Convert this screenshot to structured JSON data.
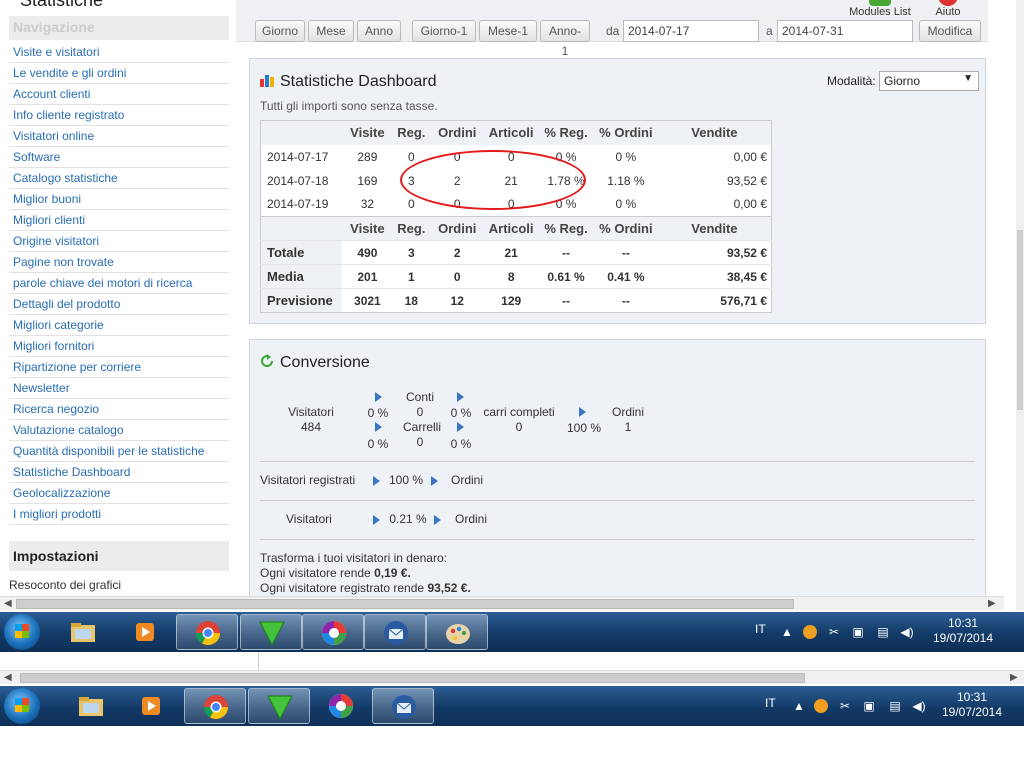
{
  "page": {
    "title": "Statistiche"
  },
  "sidebar": {
    "nav_heading": "Navigazione",
    "items": [
      "Visite e visitatori",
      "Le vendite e gli ordini",
      "Account clienti",
      "Info cliente registrato",
      "Visitatori online",
      "Software",
      "Catalogo statistiche",
      "Miglior buoni",
      "Migliori clienti",
      "Origine visitatori",
      "Pagine non trovate",
      "parole chiave dei motori di ricerca",
      "Dettagli del prodotto",
      "Migliori categorie",
      "Migliori fornitori",
      "Ripartizione per corriere",
      "Newsletter",
      "Ricerca negozio",
      "Valutazione catalogo",
      "Quantità disponibili per le statistiche",
      "Statistiche Dashboard",
      "Geolocalizzazione",
      "I migliori prodotti"
    ],
    "settings_heading": "Impostazioni",
    "settings_item": "Resoconto dei grafici"
  },
  "toolbar": {
    "modules_list": "Modules List",
    "help": "Aiuto",
    "buttons": [
      "Giorno",
      "Mese",
      "Anno",
      "Giorno-1",
      "Mese-1",
      "Anno-1"
    ],
    "from_label": "da",
    "from_value": "2014-07-17",
    "to_label": "a",
    "to_value": "2014-07-31",
    "submit": "Modifica"
  },
  "dashboard": {
    "title": "Statistiche Dashboard",
    "mode_label": "Modalità:",
    "mode_value": "Giorno",
    "note": "Tutti gli importi sono senza tasse.",
    "headers": [
      "",
      "Visite",
      "Reg.",
      "Ordini",
      "Articoli",
      "% Reg.",
      "% Ordini",
      "Vendite"
    ],
    "rows": [
      [
        "2014-07-17",
        "289",
        "0",
        "0",
        "0",
        "0 %",
        "0 %",
        "0,00 €"
      ],
      [
        "2014-07-18",
        "169",
        "3",
        "2",
        "21",
        "1.78 %",
        "1.18 %",
        "93,52 €"
      ],
      [
        "2014-07-19",
        "32",
        "0",
        "0",
        "0",
        "0 %",
        "0 %",
        "0,00 €"
      ]
    ],
    "summary": [
      [
        "Totale",
        "490",
        "3",
        "2",
        "21",
        "--",
        "--",
        "93,52 €"
      ],
      [
        "Media",
        "201",
        "1",
        "0",
        "8",
        "0.61 %",
        "0.41 %",
        "38,45 €"
      ],
      [
        "Previsione",
        "3021",
        "18",
        "12",
        "129",
        "--",
        "--",
        "576,71 €"
      ]
    ]
  },
  "conversion": {
    "title": "Conversione",
    "visitors_label": "Visitatori",
    "visitors_value": "484",
    "pct_a": "0 %",
    "accounts_label": "Conti",
    "accounts_value": "0",
    "pct_b": "0 %",
    "carts_label": "Carrelli",
    "carts_value": "0",
    "pct_c": "0 %",
    "pct_d": "0 %",
    "full_carts_label": "carri completi",
    "full_carts_value": "0",
    "pct_e": "100 %",
    "orders_label": "Ordini",
    "orders_value": "1",
    "reg_label": "Visitatori registrati",
    "reg_pct": "100 %",
    "reg_orders": "Ordini",
    "vis_label": "Visitatori",
    "vis_pct": "0.21 %",
    "vis_orders": "Ordini",
    "money_title": "Trasforma i tuoi visitatori in denaro:",
    "money_line1_prefix": "Ogni visitatore rende",
    "money_line1_value": "0,19 €.",
    "money_line2_prefix": "Ogni visitatore registrato rende",
    "money_line2_value": "93,52 €."
  },
  "taskbar": {
    "lang": "IT",
    "time": "10:31",
    "date": "19/07/2014"
  }
}
